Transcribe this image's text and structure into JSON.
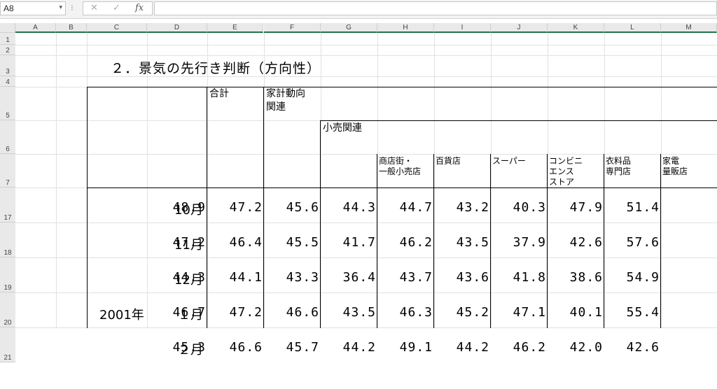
{
  "formula_bar": {
    "name_box": "A8",
    "cancel_icon": "✕",
    "enter_icon": "✓",
    "fx_label": "fx",
    "content": ""
  },
  "columns": [
    "A",
    "B",
    "C",
    "D",
    "E",
    "F",
    "G",
    "H",
    "I",
    "J",
    "K",
    "L",
    "M"
  ],
  "rows": [
    "1",
    "2",
    "3",
    "4",
    "5",
    "6",
    "7",
    "17",
    "18",
    "19",
    "20",
    "21"
  ],
  "title": "２．景気の先行き判断（方向性）",
  "headers": {
    "total": "合計",
    "household_l1": "家計動向",
    "household_l2": "関連",
    "retail": "小売関連",
    "sub": [
      [
        "商店街・",
        "一般小売店",
        ""
      ],
      [
        "百貨店",
        "",
        ""
      ],
      [
        "スーパー",
        "",
        ""
      ],
      [
        "コンビニ",
        "エンス",
        "ストア"
      ],
      [
        "衣料品",
        "専門店",
        ""
      ],
      [
        "家電",
        "量販店",
        ""
      ]
    ]
  },
  "year_label": "2001年",
  "data_rows": [
    {
      "year": "",
      "month": "10月",
      "values": [
        "48.9",
        "47.2",
        "45.6",
        "44.3",
        "44.7",
        "43.2",
        "40.3",
        "47.9",
        "51.4"
      ]
    },
    {
      "year": "",
      "month": "11月",
      "values": [
        "47.2",
        "46.4",
        "45.5",
        "41.7",
        "46.2",
        "43.5",
        "37.9",
        "42.6",
        "57.6"
      ]
    },
    {
      "year": "",
      "month": "12月",
      "values": [
        "44.3",
        "44.1",
        "43.3",
        "36.4",
        "43.7",
        "43.6",
        "41.8",
        "38.6",
        "54.9"
      ]
    },
    {
      "year": "2001年",
      "month": "１月",
      "values": [
        "46.7",
        "47.2",
        "46.6",
        "43.5",
        "46.3",
        "45.2",
        "47.1",
        "40.1",
        "55.4"
      ]
    },
    {
      "year": "",
      "month": "２月",
      "values": [
        "45.3",
        "46.6",
        "45.7",
        "44.2",
        "49.1",
        "44.2",
        "46.2",
        "42.0",
        "42.6"
      ]
    }
  ]
}
